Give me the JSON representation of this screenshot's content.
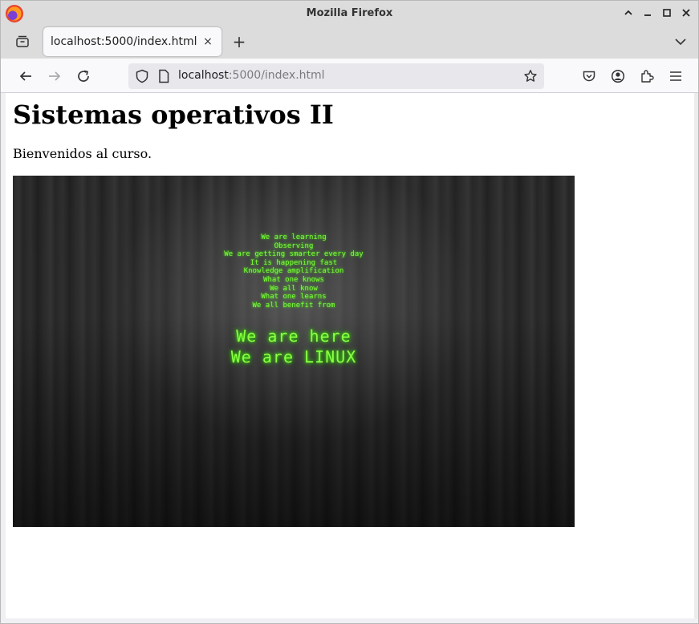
{
  "window": {
    "title": "Mozilla Firefox"
  },
  "tab": {
    "title": "localhost:5000/index.html",
    "close_glyph": "×"
  },
  "new_tab_glyph": "+",
  "address": {
    "host": "localhost",
    "path": ":5000/index.html"
  },
  "page": {
    "heading": "Sistemas operativos II",
    "paragraph": "Bienvenidos al curso.",
    "image_text": {
      "lines": [
        "We are learning",
        "Observing",
        "We are getting smarter every day",
        "It is happening fast",
        "Knowledge amplification",
        "What one knows",
        "We all know",
        "What one learns",
        "We all benefit from"
      ],
      "big_lines": [
        "We are here",
        "We are LINUX"
      ]
    }
  },
  "colors": {
    "accent_green": "#7dff3a",
    "titlebar": "#dcdcdc"
  }
}
